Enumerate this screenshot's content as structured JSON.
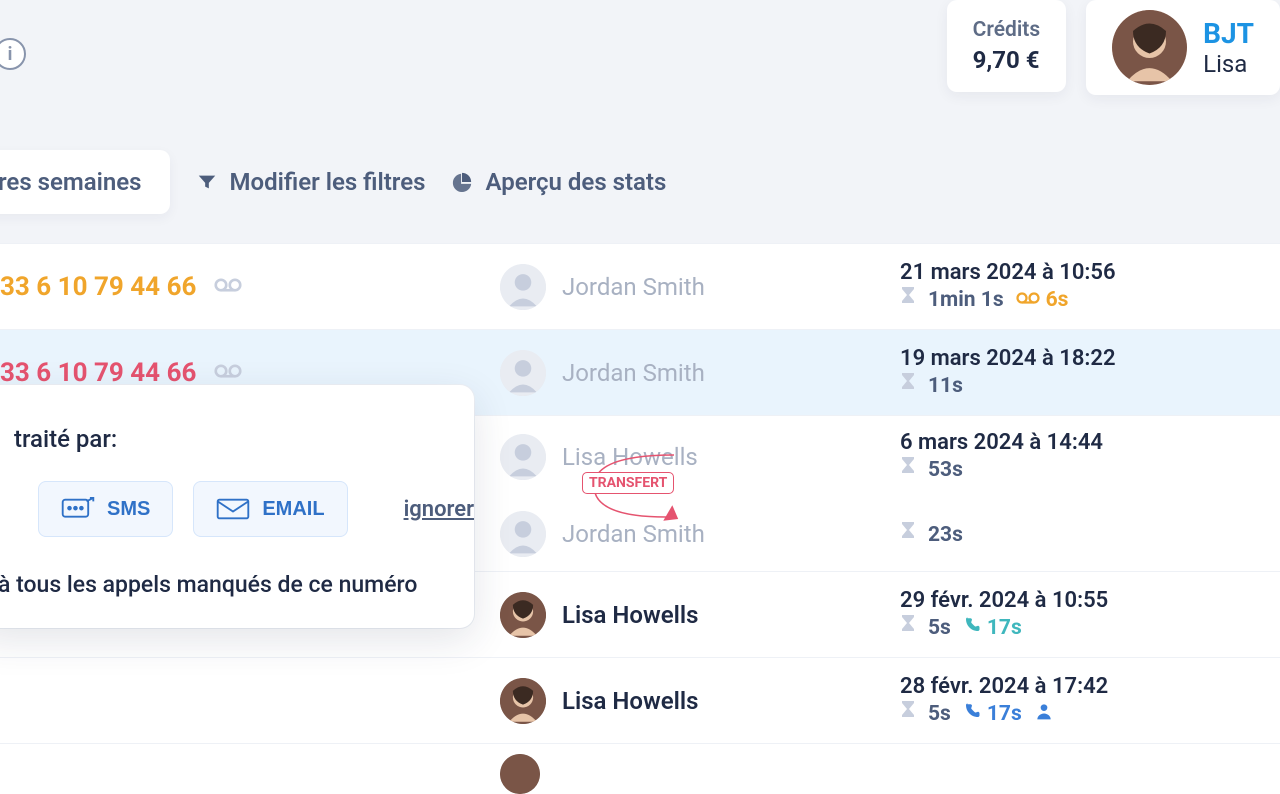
{
  "header": {
    "credits_label": "Crédits",
    "credits_value": "9,70 €",
    "user_org": "BJT",
    "user_name": "Lisa"
  },
  "toolbar": {
    "period_pill": "res semaines",
    "filter_label": "Modifier les filtres",
    "stats_label": "Aperçu des stats"
  },
  "phone": "33 6 10 79 44 66",
  "transfer_label": "TRANSFERT",
  "popup": {
    "title_suffix": "traité par:",
    "sms_label": "SMS",
    "email_label": "EMAIL",
    "ignore_label": "ignorer",
    "note": "à tous les appels manqués de ce numéro"
  },
  "calls": [
    {
      "agent": "Jordan Smith",
      "date": "21 mars 2024 à 10:56",
      "wait": "1min 1s",
      "vm": "6s"
    },
    {
      "agent": "Jordan Smith",
      "date": "19 mars 2024 à 18:22",
      "wait": "11s"
    },
    {
      "top": {
        "agent": "Lisa Howells",
        "date": "6 mars 2024 à 14:44",
        "wait": "53s"
      },
      "bottom": {
        "agent": "Jordan Smith",
        "wait": "23s"
      }
    },
    {
      "agent": "Lisa Howells",
      "date": "29 févr. 2024 à 10:55",
      "wait": "5s",
      "call": "17s",
      "call_color": "teal"
    },
    {
      "agent": "Lisa Howells",
      "date": "28 févr. 2024 à 17:42",
      "wait": "5s",
      "call": "17s",
      "call_color": "blue",
      "person": true
    }
  ]
}
